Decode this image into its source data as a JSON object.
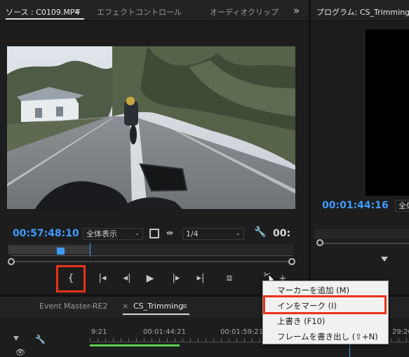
{
  "source_panel": {
    "tabs": [
      {
        "label": "ソース : C0109.MP4",
        "active": true
      },
      {
        "label": "エフェクトコントロール",
        "active": false
      },
      {
        "label": "オーディオクリップ",
        "active": false
      }
    ],
    "menu_icon": "≡",
    "expand_icon": "»",
    "timecode": "00:57:48:10",
    "zoom_select": "全体表示",
    "resolution_select": "1/4",
    "right_timecode": "00:"
  },
  "program_panel": {
    "tab_label": "プログラム: CS_Trimming",
    "timecode": "00:01:44:16",
    "zoom_select": "全体"
  },
  "transport": {
    "mark_in_symbol": "{",
    "icons": [
      "mark-in-icon",
      "go-to-in-icon",
      "step-back-icon",
      "play-icon",
      "step-forward-icon",
      "go-to-out-icon",
      "insert-icon",
      "button-editor-icon",
      "add-icon"
    ]
  },
  "context_menu": {
    "items": [
      {
        "label": "マーカーを追加 (M)",
        "highlighted": false
      },
      {
        "label": "インをマーク (I)",
        "highlighted": true
      },
      {
        "label": "上書き (F10)",
        "highlighted": false
      },
      {
        "label": "フレームを書き出し (⇧+N)",
        "highlighted": false
      }
    ]
  },
  "timeline": {
    "tabs": [
      {
        "label": "Event Master-RE2",
        "active": false
      },
      {
        "label": "CS_Trimming",
        "active": true
      }
    ],
    "close_symbol": "×",
    "ruler": [
      "9:21",
      "00:01:44:21",
      "00:01:59:21",
      "29:20"
    ]
  },
  "colors": {
    "accent_blue": "#3d9bff",
    "highlight_red": "#e8321b",
    "panel_bg": "#1d1d1d"
  }
}
